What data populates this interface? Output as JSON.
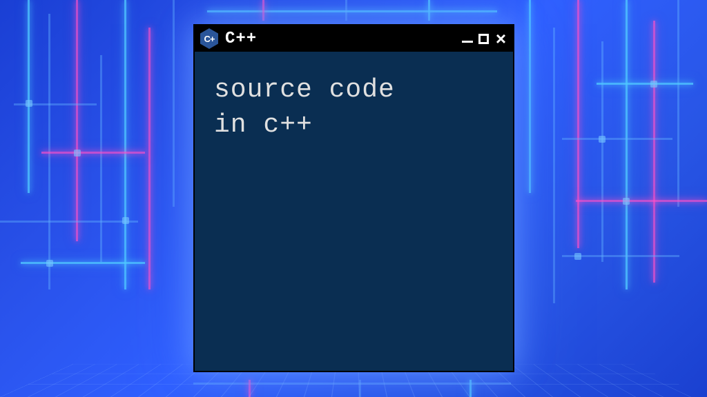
{
  "window": {
    "title": "C++",
    "logo_text": "C+"
  },
  "content": {
    "line1": "source code",
    "line2": "in c++"
  }
}
